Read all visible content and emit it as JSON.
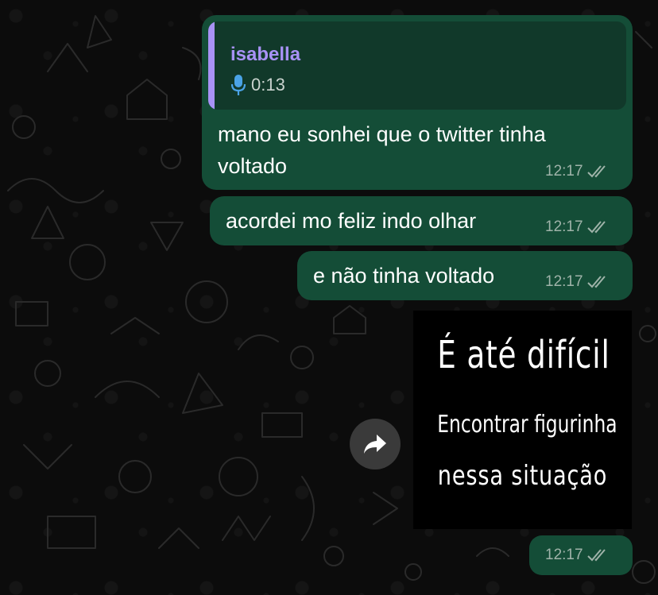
{
  "messages": [
    {
      "reply": {
        "author": "isabella",
        "audio_duration": "0:13",
        "icon": "microphone-icon"
      },
      "text": "mano eu sonhei que o twitter tinha\nvoltado",
      "time": "12:17",
      "status": "read"
    },
    {
      "text": "acordei mo feliz indo olhar",
      "time": "12:17",
      "status": "read"
    },
    {
      "text": "e não tinha voltado",
      "time": "12:17",
      "status": "read"
    },
    {
      "sticker": {
        "line1": "É até difícil",
        "line2": "Encontrar figurinha",
        "line3": "nessa situação"
      },
      "time": "12:17",
      "status": "read"
    }
  ],
  "icons": {
    "forward": "forward-arrow-icon",
    "read_receipt": "double-check-icon",
    "mic": "microphone-icon"
  },
  "colors": {
    "bubble_outgoing": "#144d37",
    "quote_background": "#11392a",
    "quote_accent": "#a892f5",
    "mic_icon": "#4aa3e6",
    "background": "#0c0c0c"
  }
}
